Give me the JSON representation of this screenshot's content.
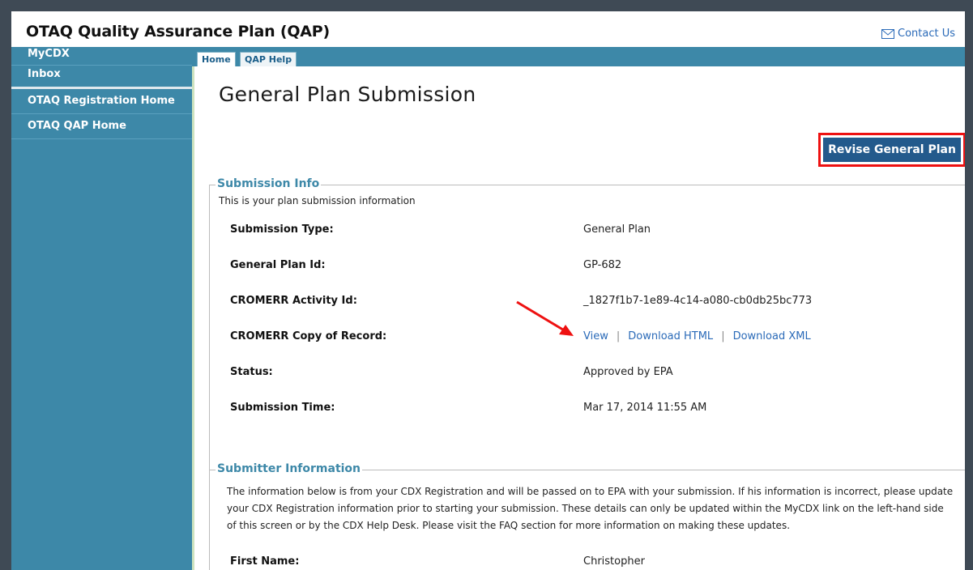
{
  "app": {
    "title": "OTAQ Quality Assurance Plan (QAP)",
    "contact_label": "Contact Us"
  },
  "sidebar": {
    "items": [
      {
        "label": "MyCDX"
      },
      {
        "label": "Inbox"
      },
      {
        "label": "OTAQ Registration Home"
      },
      {
        "label": "OTAQ QAP Home"
      }
    ]
  },
  "tabs": [
    {
      "label": "Home",
      "active": true
    },
    {
      "label": "QAP Help",
      "active": false
    }
  ],
  "main": {
    "page_title": "General Plan Submission",
    "revise_label": "Revise General Plan",
    "submission_info": {
      "legend": "Submission Info",
      "description": "This is your plan submission information",
      "rows": [
        {
          "label": "Submission Type:",
          "value": "General Plan"
        },
        {
          "label": "General Plan Id:",
          "value": "GP-682"
        },
        {
          "label": "CROMERR Activity Id:",
          "value": "_1827f1b7-1e89-4c14-a080-cb0db25bc773"
        },
        {
          "label": "CROMERR Copy of Record:",
          "links": [
            "View",
            "Download HTML",
            "Download XML"
          ],
          "separator": "|"
        },
        {
          "label": "Status:",
          "value": "Approved by EPA"
        },
        {
          "label": "Submission Time:",
          "value": "Mar 17, 2014 11:55 AM"
        }
      ]
    },
    "submitter_info": {
      "legend": "Submitter Information",
      "description": "The information below is from your CDX Registration and will be passed on to EPA with your submission. If his information is incorrect, please update your CDX Registration information prior to starting your submission. These details can only be updated within the MyCDX link on the left-hand side of this screen or by the CDX Help Desk. Please visit the FAQ section for more information on making these updates.",
      "rows": [
        {
          "label": "First Name:",
          "value": "Christopher"
        }
      ]
    }
  },
  "colors": {
    "sidebar": "#3d88a8",
    "button": "#235a8c",
    "highlight": "#ee1111",
    "link": "#2a6ab8"
  }
}
